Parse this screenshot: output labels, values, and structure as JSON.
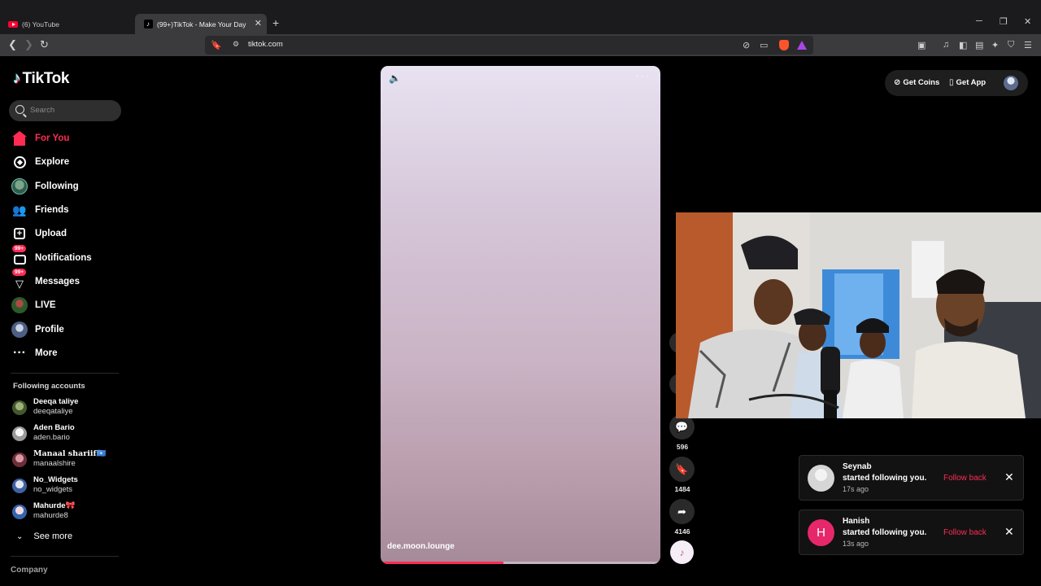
{
  "browser": {
    "tabs": [
      {
        "title": "(6) YouTube",
        "active": false
      },
      {
        "title": "(99+)TikTok - Make Your Day",
        "active": true
      }
    ],
    "url": "tiktok.com",
    "brave_badge": "6"
  },
  "tiktok": {
    "logo": "TikTok",
    "search_placeholder": "Search",
    "nav": [
      {
        "label": "For You",
        "icon": "house-icon",
        "active": true
      },
      {
        "label": "Explore",
        "icon": "compass-icon"
      },
      {
        "label": "Following",
        "icon": "following-avatar-icon"
      },
      {
        "label": "Friends",
        "icon": "friends-icon"
      },
      {
        "label": "Upload",
        "icon": "upload-icon"
      },
      {
        "label": "Notifications",
        "icon": "notifications-icon",
        "badge": "99+"
      },
      {
        "label": "Messages",
        "icon": "messages-icon",
        "badge": "99+"
      },
      {
        "label": "LIVE",
        "icon": "live-icon"
      },
      {
        "label": "Profile",
        "icon": "profile-avatar-icon"
      },
      {
        "label": "More",
        "icon": "more-icon"
      }
    ],
    "following_title": "Following accounts",
    "following": [
      {
        "name": "Deeqa taliye",
        "handle": "deeqataliye",
        "color": "#6b8a4e"
      },
      {
        "name": "Aden Bario",
        "handle": "aden.bario",
        "color": "#d9d9d9"
      },
      {
        "name": "Manaal shariif🇸🇴",
        "handle": "manaalshire",
        "color": "#9b4b5a"
      },
      {
        "name": "No_Widgets",
        "handle": "no_widgets",
        "color": "#4a6fb0"
      },
      {
        "name": "Mahurde🎀",
        "handle": "mahurde8",
        "color": "#3d6fb8"
      }
    ],
    "see_more": "See more",
    "company": "Company",
    "top_actions": {
      "coins": "Get Coins",
      "app": "Get App"
    },
    "video": {
      "author": "dee.moon.lounge",
      "progress": 0.44,
      "comments": "596",
      "saves": "1484",
      "shares": "4146"
    },
    "notifications": [
      {
        "name": "Seynab",
        "message": "started following you.",
        "time": "17s ago",
        "action": "Follow back",
        "avatar": "",
        "avatar_color": "#d6d6d6"
      },
      {
        "name": "Hanish",
        "message": "started following you.",
        "time": "13s ago",
        "action": "Follow back",
        "avatar": "H",
        "avatar_color": "#e6286b"
      }
    ]
  }
}
